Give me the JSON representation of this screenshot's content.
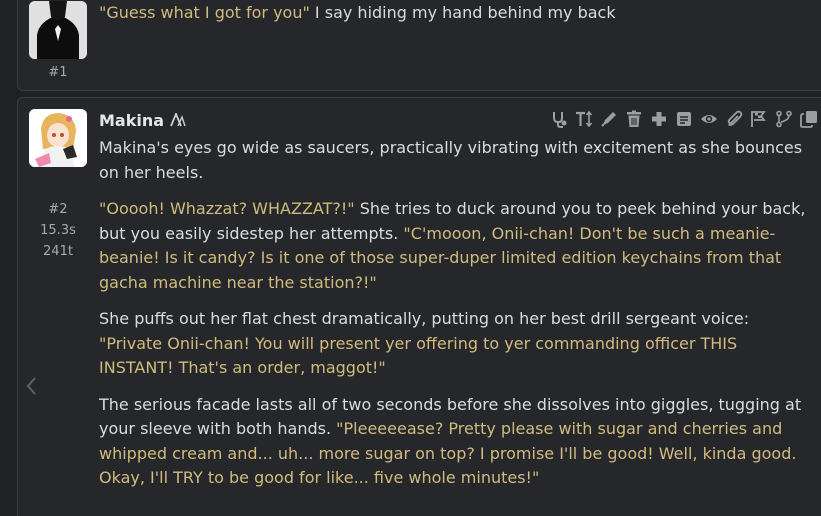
{
  "colors": {
    "background": "#202124",
    "message_bg": "#25272a",
    "body_text": "#dcdcdc",
    "quote_text": "#d1bb7e",
    "muted_text": "#a7a9ad",
    "icon_gray": "#9c9ea3"
  },
  "previous_message": {
    "id": "#1",
    "segments": [
      {
        "type": "quote",
        "text": "\"Guess what I got for you\""
      },
      {
        "type": "text",
        "text": " I say hiding my hand behind my back"
      }
    ]
  },
  "message": {
    "author": "Makina",
    "author_badge_icon": "model-a-icon",
    "id": "#2",
    "gen_time": "15.3s",
    "tokens": "241t",
    "toolbar_icons": [
      "stethoscope-icon",
      "text-size-icon",
      "pen-icon",
      "trash-icon",
      "plus-icon",
      "note-icon",
      "eye-icon",
      "paperclip-icon",
      "flags-icon",
      "branch-icon",
      "copy-icon"
    ],
    "paragraphs": [
      [
        {
          "type": "text",
          "text": "Makina's eyes go wide as saucers, practically vibrating with excitement as she bounces on her heels."
        }
      ],
      [
        {
          "type": "quote",
          "text": "\"Ooooh! Whazzat? WHAZZAT?!\""
        },
        {
          "type": "text",
          "text": " She tries to duck around you to peek behind your back, but you easily sidestep her attempts. "
        },
        {
          "type": "quote",
          "text": "\"C'mooon, Onii-chan! Don't be such a meanie-beanie! Is it candy? Is it one of those super-duper limited edition keychains from that gacha machine near the station?!\""
        }
      ],
      [
        {
          "type": "text",
          "text": "She puffs out her flat chest dramatically, putting on her best drill sergeant voice: "
        },
        {
          "type": "quote",
          "text": "\"Private Onii-chan! You will present yer offering to yer commanding officer THIS INSTANT! That's an order, maggot!\""
        }
      ],
      [
        {
          "type": "text",
          "text": "The serious facade lasts all of two seconds before she dissolves into giggles, tugging at your sleeve with both hands. "
        },
        {
          "type": "quote",
          "text": "\"Pleeeeease? Pretty please with sugar and cherries and whipped cream and... uh... more sugar on top? I promise I'll be good! Well, kinda good. Okay, I'll TRY to be good for like... five whole minutes!\""
        }
      ]
    ]
  },
  "swipe_left_icon": "chevron-left-icon"
}
